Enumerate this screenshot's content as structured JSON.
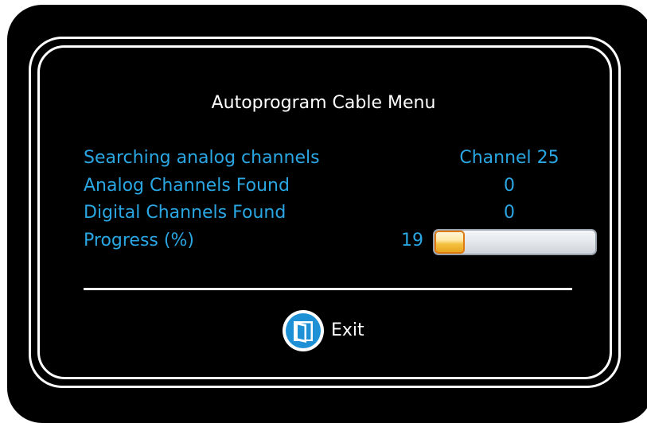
{
  "menu": {
    "title": "Autoprogram Cable Menu"
  },
  "rows": [
    {
      "label": "Searching analog channels",
      "value": "Channel 25"
    },
    {
      "label": "Analog Channels Found",
      "value": "0"
    },
    {
      "label": "Digital Channels Found",
      "value": "0"
    },
    {
      "label": "Progress (%)",
      "value": "19"
    }
  ],
  "progress": {
    "percent": 19
  },
  "exit": {
    "label": "Exit",
    "icon": "exit-door-icon"
  },
  "colors": {
    "accent_text": "#2aa7e2",
    "background": "#000000",
    "frame": "#ffffff",
    "progress_fill": "#f4c040",
    "exit_icon": "#1e90d6"
  }
}
